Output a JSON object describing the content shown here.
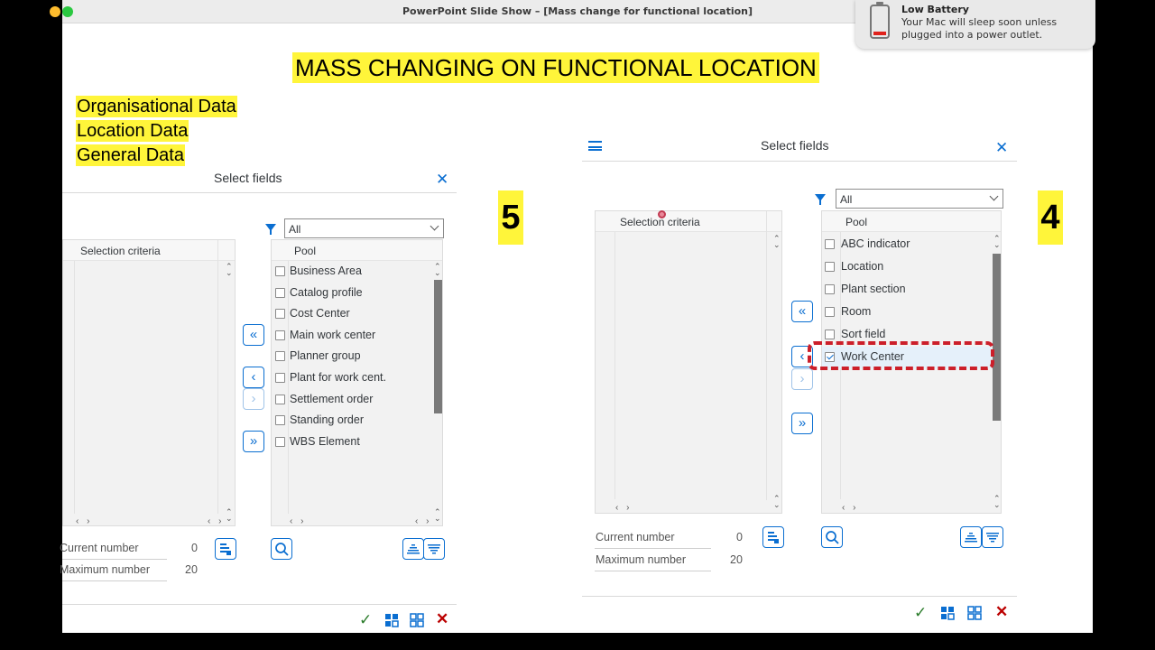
{
  "window": {
    "title": "PowerPoint Slide Show – [Mass change for functional location]"
  },
  "notification": {
    "title": "Low Battery",
    "message": "Your Mac will sleep soon unless plugged into a power outlet."
  },
  "slide": {
    "title": "MASS CHANGING ON FUNCTIONAL LOCATION",
    "data_sections": [
      "Organisational Data",
      "Location Data",
      "General Data"
    ],
    "step_left": "5",
    "step_right": "4"
  },
  "left_dialog": {
    "title": "Select fields",
    "selection_header": "Selection criteria",
    "filter_value": "All",
    "pool_header": "Pool",
    "pool_items": [
      {
        "label": "Business Area",
        "checked": false
      },
      {
        "label": "Catalog profile",
        "checked": false
      },
      {
        "label": "Cost Center",
        "checked": false
      },
      {
        "label": "Main work center",
        "checked": false
      },
      {
        "label": "Planner group",
        "checked": false
      },
      {
        "label": "Plant for work cent.",
        "checked": false
      },
      {
        "label": "Settlement order",
        "checked": false
      },
      {
        "label": "Standing order",
        "checked": false
      },
      {
        "label": "WBS Element",
        "checked": false
      }
    ],
    "current_number_label": "Current number",
    "current_number": "0",
    "maximum_number_label": "Maximum number",
    "maximum_number": "20"
  },
  "right_dialog": {
    "title": "Select fields",
    "selection_header": "Selection criteria",
    "filter_value": "All",
    "pool_header": "Pool",
    "pool_items": [
      {
        "label": "ABC indicator",
        "checked": false
      },
      {
        "label": "Location",
        "checked": false
      },
      {
        "label": "Plant section",
        "checked": false
      },
      {
        "label": "Room",
        "checked": false
      },
      {
        "label": "Sort field",
        "checked": false
      },
      {
        "label": "Work Center",
        "checked": true
      }
    ],
    "current_number_label": "Current number",
    "current_number": "0",
    "maximum_number_label": "Maximum number",
    "maximum_number": "20"
  },
  "icons": {
    "confirm": "checkmark-icon",
    "select_all": "select-all-icon",
    "deselect_all": "deselect-all-icon",
    "cancel": "cancel-x-icon"
  },
  "colors": {
    "highlight": "#fff53a",
    "sap_blue": "#0a6ed1",
    "annotation_red": "#cc1f2a",
    "confirm_green": "#2b7c2b",
    "cancel_red": "#bb0000"
  }
}
